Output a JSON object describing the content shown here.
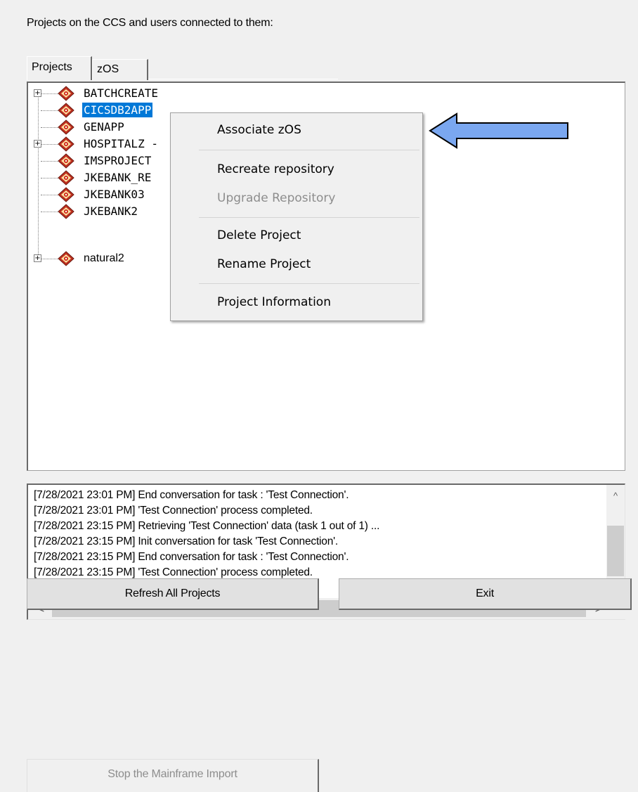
{
  "heading": "Projects on the CCS and users connected to them:",
  "tabs": [
    {
      "label": "Projects",
      "active": true
    },
    {
      "label": "zOS",
      "active": false
    }
  ],
  "tree": {
    "items": [
      {
        "label": "BATCHCREATE",
        "expandable": true,
        "selected": false
      },
      {
        "label": "CICSDB2APP",
        "expandable": false,
        "selected": true
      },
      {
        "label": "GENAPP",
        "expandable": false,
        "selected": false
      },
      {
        "label": "HOSPITALZ -",
        "expandable": true,
        "selected": false
      },
      {
        "label": "IMSPROJECT",
        "expandable": false,
        "selected": false
      },
      {
        "label": "JKEBANK_RE",
        "expandable": false,
        "selected": false
      },
      {
        "label": "JKEBANK03",
        "expandable": false,
        "selected": false
      },
      {
        "label": "JKEBANK2",
        "expandable": false,
        "selected": false
      },
      {
        "label": "natural2",
        "expandable": true,
        "selected": false
      }
    ],
    "expander_glyph": "+",
    "item_icon": "project-icon"
  },
  "context_menu": {
    "items": [
      {
        "label": "Associate zOS",
        "enabled": true
      },
      {
        "label": "Recreate repository",
        "enabled": true
      },
      {
        "label": "Upgrade Repository",
        "enabled": false
      },
      {
        "label": "Delete Project",
        "enabled": true
      },
      {
        "label": "Rename Project",
        "enabled": true
      },
      {
        "label": "Project Information",
        "enabled": true
      }
    ]
  },
  "annotation": {
    "arrow_color": "#7aa7f0",
    "icon": "pointer-arrow-icon"
  },
  "log": {
    "lines": [
      "[7/28/2021  23:01 PM]  End conversation for task : 'Test Connection'.",
      "[7/28/2021  23:01 PM]  'Test Connection' process completed.",
      "[7/28/2021  23:15 PM]  Retrieving 'Test Connection' data (task 1 out of 1) ...",
      "[7/28/2021  23:15 PM]  Init conversation for task 'Test Connection'.",
      "[7/28/2021  23:15 PM]  End conversation for task : 'Test Connection'.",
      "[7/28/2021  23:15 PM]  'Test Connection' process completed."
    ],
    "scroll_up_glyph": "^",
    "scroll_down_glyph": "v",
    "scroll_left_glyph": "<",
    "scroll_right_glyph": ">"
  },
  "buttons": {
    "refresh": "Refresh All Projects",
    "exit": "Exit",
    "stop": "Stop the Mainframe Import"
  },
  "colors": {
    "selection": "#0078d7",
    "background": "#f0f0f0",
    "disabled_text": "#8d8d8d"
  }
}
